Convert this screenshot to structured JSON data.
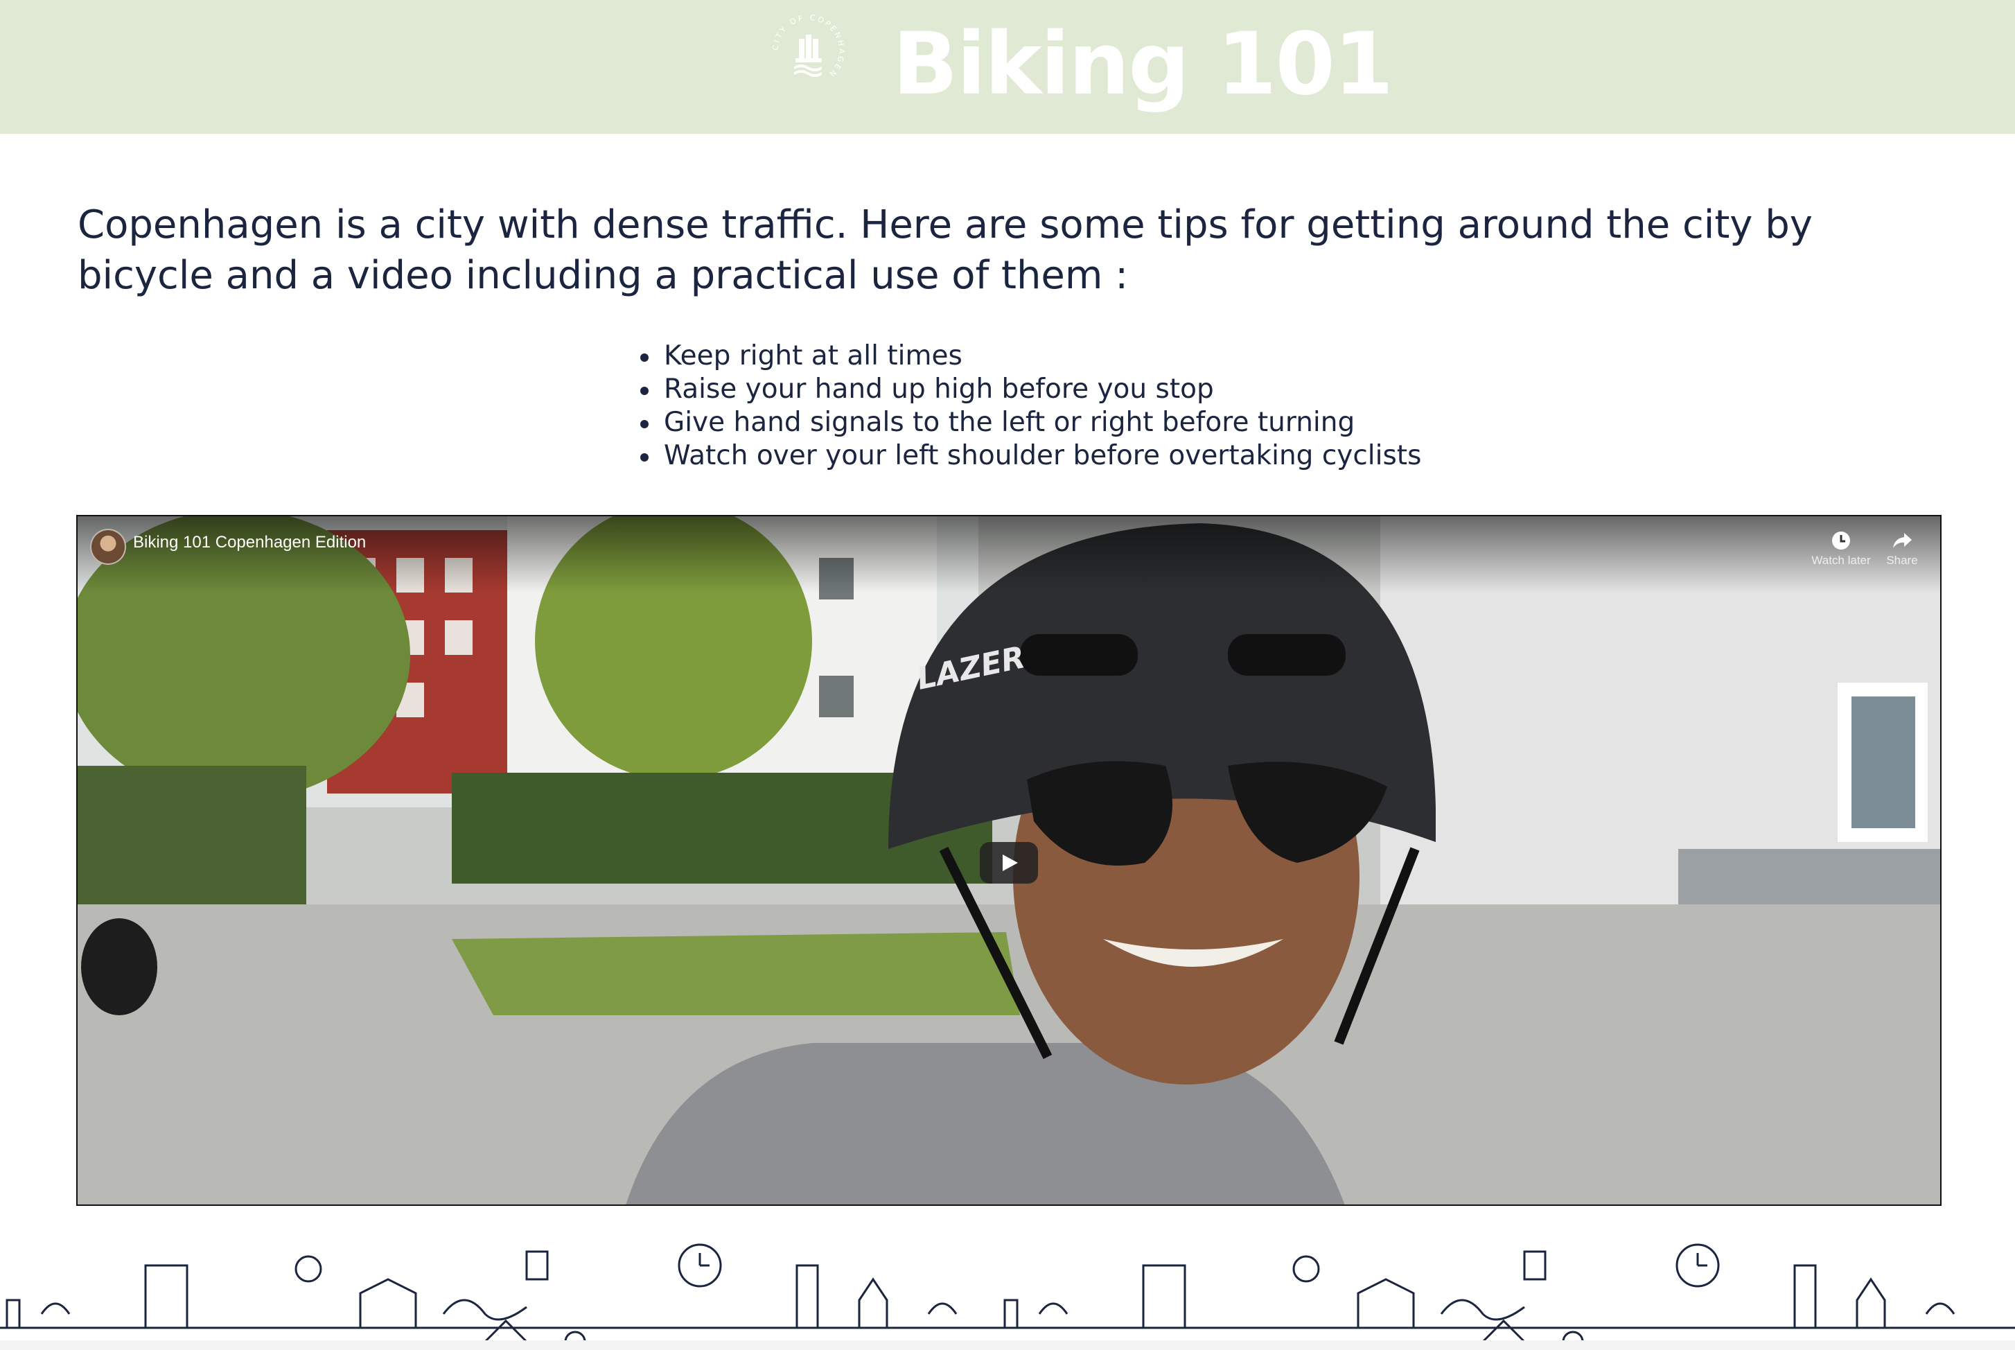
{
  "header": {
    "title": "Biking 101",
    "logo_text": "CITY OF COPENHAGEN",
    "background": "#e0e9d4"
  },
  "intro": {
    "text": "Copenhagen is a city with dense traffic. Here are some tips for getting around the city by bicycle and a video including a practical use of them :"
  },
  "tips": [
    "Keep right at all times",
    "Raise your hand up high before you stop",
    "Give hand signals to the left or right before turning",
    "Watch over your left shoulder before overtaking cyclists"
  ],
  "video": {
    "title": "Biking 101 Copenhagen Edition",
    "watch_later_label": "Watch later",
    "share_label": "Share",
    "helmet_brand": "LAZER"
  },
  "colors": {
    "text": "#1b2540",
    "header_bg": "#e0e9d4",
    "header_text": "#ffffff"
  }
}
